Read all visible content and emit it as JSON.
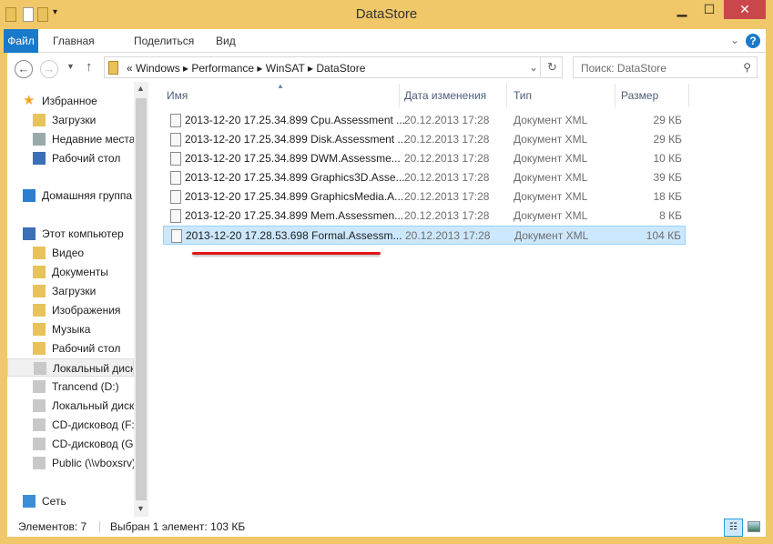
{
  "window": {
    "title": "DataStore",
    "minimize": "▁",
    "maximize": "☐",
    "close": "✕"
  },
  "ribbon": {
    "tabs": [
      "Файл",
      "Главная",
      "Поделиться",
      "Вид"
    ],
    "help": "?"
  },
  "address": {
    "crumbs": "«  Windows  ▸  Performance  ▸  WinSAT  ▸  DataStore"
  },
  "search": {
    "placeholder": "Поиск: DataStore"
  },
  "sidebar": {
    "items": [
      {
        "label": "Избранное",
        "icon": "star-icon"
      },
      {
        "label": "Загрузки",
        "icon": "downloads-folder-icon"
      },
      {
        "label": "Недавние места",
        "icon": "recent-places-icon"
      },
      {
        "label": "Рабочий стол",
        "icon": "desktop-icon"
      },
      {
        "label": "Домашняя группа",
        "icon": "homegroup-icon"
      },
      {
        "label": "Этот компьютер",
        "icon": "computer-icon"
      },
      {
        "label": "Видео",
        "icon": "video-folder-icon"
      },
      {
        "label": "Документы",
        "icon": "documents-folder-icon"
      },
      {
        "label": "Загрузки",
        "icon": "downloads-folder-icon"
      },
      {
        "label": "Изображения",
        "icon": "pictures-folder-icon"
      },
      {
        "label": "Музыка",
        "icon": "music-folder-icon"
      },
      {
        "label": "Рабочий стол",
        "icon": "desktop-folder-icon"
      },
      {
        "label": "Локальный диск (C:)",
        "icon": "system-drive-icon"
      },
      {
        "label": "Trancend (D:)",
        "icon": "drive-icon"
      },
      {
        "label": "Локальный диск (E:)",
        "icon": "drive-icon"
      },
      {
        "label": "CD-дисковод (F:)",
        "icon": "cd-drive-icon"
      },
      {
        "label": "CD-дисковод (G:)",
        "icon": "virtualbox-cd-icon"
      },
      {
        "label": "Public (\\\\vboxsrv)",
        "icon": "network-drive-icon"
      },
      {
        "label": "Сеть",
        "icon": "network-icon"
      }
    ]
  },
  "columns": {
    "name": "Имя",
    "date": "Дата изменения",
    "type": "Тип",
    "size": "Размер"
  },
  "files": [
    {
      "name": "2013-12-20 17.25.34.899 Cpu.Assessment ...",
      "date": "20.12.2013 17:28",
      "type": "Документ XML",
      "size": "29 КБ"
    },
    {
      "name": "2013-12-20 17.25.34.899 Disk.Assessment ...",
      "date": "20.12.2013 17:28",
      "type": "Документ XML",
      "size": "29 КБ"
    },
    {
      "name": "2013-12-20 17.25.34.899 DWM.Assessme...",
      "date": "20.12.2013 17:28",
      "type": "Документ XML",
      "size": "10 КБ"
    },
    {
      "name": "2013-12-20 17.25.34.899 Graphics3D.Asse...",
      "date": "20.12.2013 17:28",
      "type": "Документ XML",
      "size": "39 КБ"
    },
    {
      "name": "2013-12-20 17.25.34.899 GraphicsMedia.A...",
      "date": "20.12.2013 17:28",
      "type": "Документ XML",
      "size": "18 КБ"
    },
    {
      "name": "2013-12-20 17.25.34.899 Mem.Assessmen...",
      "date": "20.12.2013 17:28",
      "type": "Документ XML",
      "size": "8 КБ"
    },
    {
      "name": "2013-12-20 17.28.53.698 Formal.Assessm...",
      "date": "20.12.2013 17:28",
      "type": "Документ XML",
      "size": "104 КБ",
      "selected": true
    }
  ],
  "status": {
    "count": "Элементов: 7",
    "selection": "Выбран 1 элемент: 103 КБ"
  },
  "colors": {
    "frame": "#f0c86a",
    "accent": "#1979ca",
    "selection": "#cce8ff",
    "close": "#c9474b",
    "annotation": "#e0161b"
  }
}
